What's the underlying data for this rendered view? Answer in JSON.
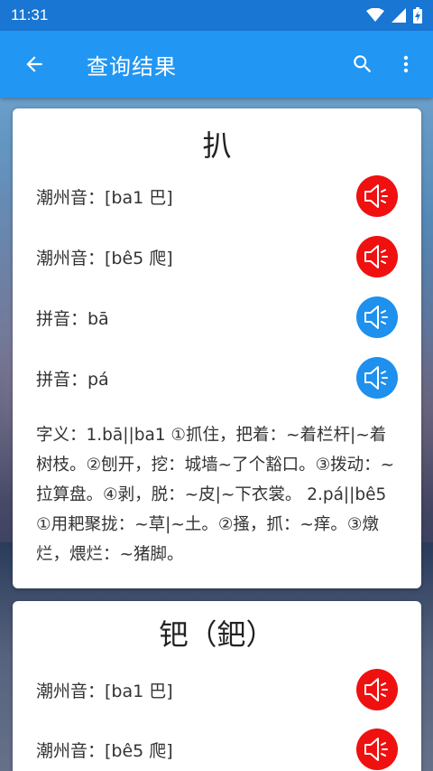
{
  "status_bar": {
    "time": "11:31"
  },
  "app_bar": {
    "title": "查询结果"
  },
  "cards": [
    {
      "title": "扒",
      "readings": [
        {
          "label": "潮州音：[ba1 巴]",
          "color": "#f01010"
        },
        {
          "label": "潮州音：[bê5 爬]",
          "color": "#f01010"
        },
        {
          "label": "拼音：bā",
          "color": "#1e90ee"
        },
        {
          "label": "拼音：pá",
          "color": "#1e90ee"
        }
      ],
      "definition": "字义：1.bā||ba1 ①抓住，把着：~着栏杆|~着树枝。②刨开，挖：城墙~了个豁口。③拨动：~拉算盘。④剥，脱：~皮|~下衣裳。 2.pá||bê5 ①用耙聚拢：~草|~土。②搔，抓：~痒。③燉烂，煨烂：~猪脚。"
    },
    {
      "title": "钯（鈀）",
      "readings": [
        {
          "label": "潮州音：[ba1 巴]",
          "color": "#f01010"
        },
        {
          "label": "潮州音：[bê5 爬]",
          "color": "#f01010"
        }
      ]
    }
  ]
}
